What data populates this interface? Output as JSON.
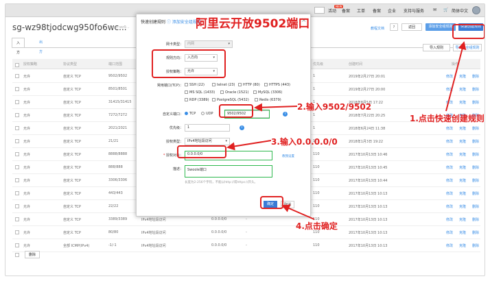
{
  "topbar": {
    "nav": [
      "活动",
      "备案",
      "工单",
      "备案",
      "企业",
      "支持与服务",
      "简体中文"
    ],
    "badge": "NEW"
  },
  "page": {
    "title": "sg-wz98tjodcwg950fo6wc...",
    "subtitle": "/ vpc-wz9...",
    "link_learn": "教程文档",
    "btn_refresh": "返回",
    "btn_add": "添加安全组规则",
    "btn_quick": "快速创建规则",
    "tabs": [
      "入方向",
      "出方向"
    ],
    "btn_import": "导入规则",
    "btn_export": "导出安全组规则"
  },
  "table": {
    "headers": [
      "授权策略",
      "协议类型",
      "端口范围",
      "授权类型(全部)",
      "授权对象",
      "描述",
      "优先级",
      "创建时间",
      "操作"
    ],
    "rows": [
      {
        "policy": "允许",
        "proto": "自定义 TCP",
        "port": "9502/9502",
        "prio": "1",
        "time": "2019年2月27日 20:01",
        "ops": [
          "修改",
          "克隆",
          "删除"
        ]
      },
      {
        "policy": "允许",
        "proto": "自定义 TCP",
        "port": "8501/8501",
        "prio": "1",
        "time": "2019年2月27日 20:00",
        "ops": [
          "修改",
          "克隆",
          "删除"
        ]
      },
      {
        "policy": "允许",
        "proto": "自定义 TCP",
        "port": "31415/31415",
        "prio": "1",
        "time": "2018年8月5日 17:22",
        "ops": [
          "修改",
          "克隆",
          "删除"
        ]
      },
      {
        "policy": "允许",
        "proto": "自定义 TCP",
        "port": "7272/7272",
        "prio": "1",
        "time": "2018年7月22日 20:25",
        "ops": [
          "修改",
          "克隆",
          "删除"
        ]
      },
      {
        "policy": "允许",
        "proto": "自定义 TCP",
        "port": "2021/2021",
        "prio": "1",
        "time": "2018年6月24日 11:38",
        "ops": [
          "修改",
          "克隆",
          "删除"
        ]
      },
      {
        "policy": "允许",
        "proto": "自定义 TCP",
        "port": "21/21",
        "prio": "1",
        "time": "2018年1月3日 19:22",
        "ops": [
          "修改",
          "克隆",
          "删除"
        ]
      },
      {
        "policy": "允许",
        "proto": "自定义 TCP",
        "port": "8888/8888",
        "prio": "110",
        "time": "2017年10月13日 10:46",
        "ops": [
          "修改",
          "克隆",
          "删除"
        ]
      },
      {
        "policy": "允许",
        "proto": "自定义 TCP",
        "port": "888/888",
        "prio": "110",
        "time": "2017年10月13日 10:45",
        "ops": [
          "修改",
          "克隆",
          "删除"
        ]
      },
      {
        "policy": "允许",
        "proto": "自定义 TCP",
        "port": "3306/3306",
        "prio": "110",
        "time": "2017年10月13日 10:44",
        "ops": [
          "修改",
          "克隆",
          "删除"
        ]
      },
      {
        "policy": "允许",
        "proto": "自定义 TCP",
        "port": "443/443",
        "prio": "110",
        "time": "2017年10月13日 10:13",
        "ops": [
          "修改",
          "克隆",
          "删除"
        ]
      },
      {
        "policy": "允许",
        "proto": "自定义 TCP",
        "port": "22/22",
        "prio": "110",
        "time": "2017年10月13日 10:13",
        "ops": [
          "修改",
          "克隆",
          "删除"
        ]
      },
      {
        "policy": "允许",
        "proto": "自定义 TCP",
        "port": "3389/3389",
        "prio": "110",
        "time": "2017年10月13日 10:13",
        "ops": [
          "修改",
          "克隆",
          "删除"
        ]
      },
      {
        "policy": "允许",
        "proto": "自定义 TCP",
        "port": "80/80",
        "prio": "110",
        "time": "2017年10月13日 10:13",
        "ops": [
          "修改",
          "克隆",
          "删除"
        ]
      },
      {
        "policy": "允许",
        "proto": "全部 ICMP(IPv4)",
        "port": "-1/-1",
        "prio": "110",
        "time": "2017年10月13日 10:13",
        "ops": [
          "修改",
          "克隆",
          "删除"
        ]
      }
    ],
    "auth_type": "IPv4地址段访问",
    "auth_obj": "0.0.0.0/0",
    "desc": "-",
    "footer_btn": "删除"
  },
  "modal": {
    "title": "快速创建规则",
    "link": "添加安全组规则",
    "nic_label": "网卡类型：",
    "nic_value": "内网",
    "dir_label": "规则方向：",
    "dir_value": "入方向",
    "policy_label": "授权策略：",
    "policy_value": "允许",
    "ports_label": "常用端口(TCP)：",
    "ports": [
      "SSH (22)",
      "telnet (23)",
      "HTTP (80)",
      "HTTPS (443)",
      "MS SQL (1433)",
      "Oracle (1521)",
      "MySQL (3306)",
      "RDP (3389)",
      "PostgreSQL (5432)",
      "Redis (6379)"
    ],
    "custom_label": "自定义端口：",
    "tcp": "TCP",
    "udp": "UDP",
    "custom_value": "9502/9502",
    "prio_label": "优先级：",
    "prio_value": "1",
    "auth_type_label": "授权类型：",
    "auth_type_value": "IPv4地址段访问",
    "auth_obj_label": "授权对象：",
    "auth_obj_value": "0.0.0.0/0",
    "auth_obj_link": "教我设置",
    "desc_label": "描述：",
    "desc_value": "Swoole端口",
    "desc_hint": "长度为2-256个字符，不能以http://或https://开头。",
    "ok": "确定",
    "cancel": "取消"
  },
  "annotations": {
    "title": "阿里云开放9502端口",
    "step1": "1.点击快速创建规则",
    "step2": "2.输入9502/9502",
    "step3": "3.输入0.0.0.0/0",
    "step4": "4.点击确定"
  }
}
